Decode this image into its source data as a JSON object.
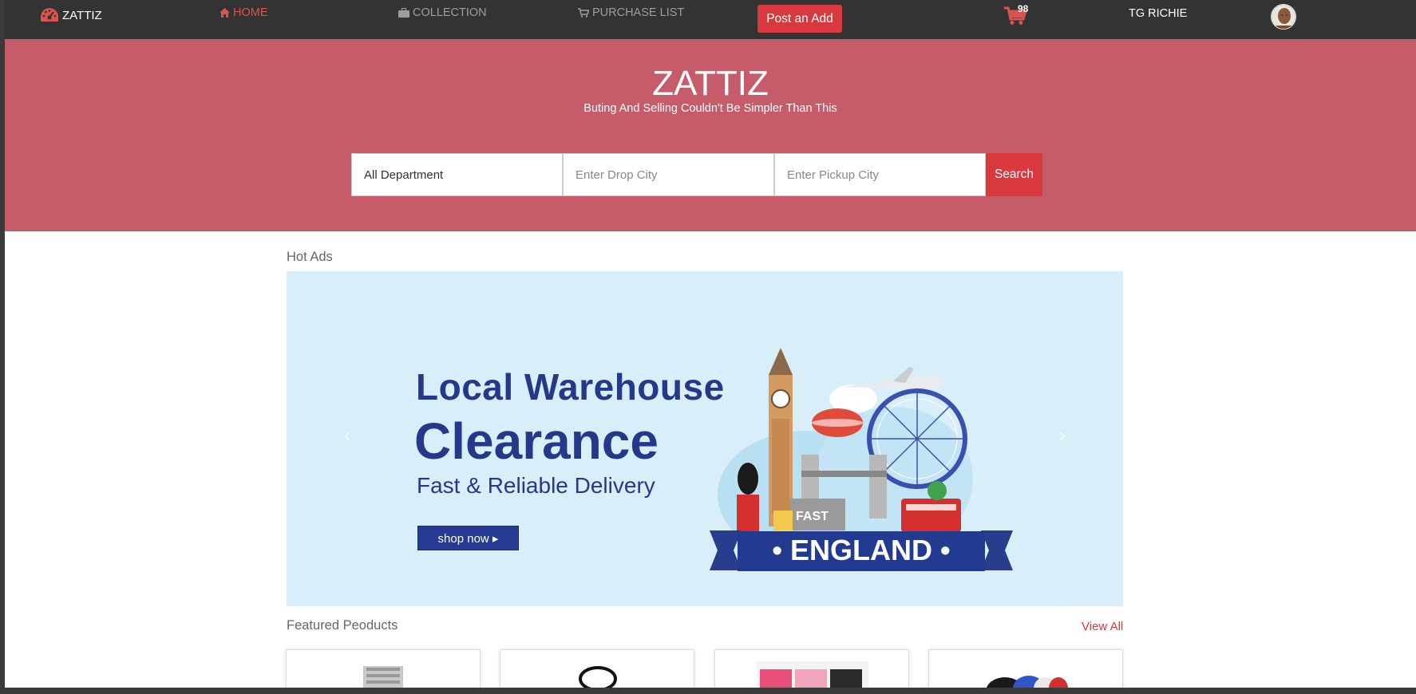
{
  "nav": {
    "brand": "ZATTIZ",
    "links": [
      {
        "label": "HOME",
        "icon": "home-icon",
        "active": true
      },
      {
        "label": "COLLECTION",
        "icon": "briefcase-icon",
        "active": false
      },
      {
        "label": "PURCHASE LIST",
        "icon": "cart-icon",
        "active": false
      }
    ],
    "post_button": "Post an Add",
    "cart_count": "98",
    "user_name": "TG RICHIE"
  },
  "hero": {
    "title": "ZATTIZ",
    "subtitle": "Buting And Selling Couldn't Be Simpler Than This",
    "department_value": "All Department",
    "drop_city_placeholder": "Enter Drop City",
    "pickup_city_placeholder": "Enter Pickup City",
    "search_button": "Search"
  },
  "hot_ads": {
    "title": "Hot Ads",
    "banner": {
      "line1": "Local  Warehouse",
      "line2": "Clearance",
      "line3": "Fast & Reliable Delivery",
      "shop_button": "shop now ▸",
      "badge_fast": "FAST",
      "ribbon": "• ENGLAND •"
    }
  },
  "featured": {
    "title": "Featured Peoducts",
    "view_all": "View All"
  },
  "colors": {
    "navbar": "#333333",
    "hero": "#c65c69",
    "accent": "#d9383f",
    "banner_bg": "#d8eef9",
    "banner_text": "#26388a"
  }
}
